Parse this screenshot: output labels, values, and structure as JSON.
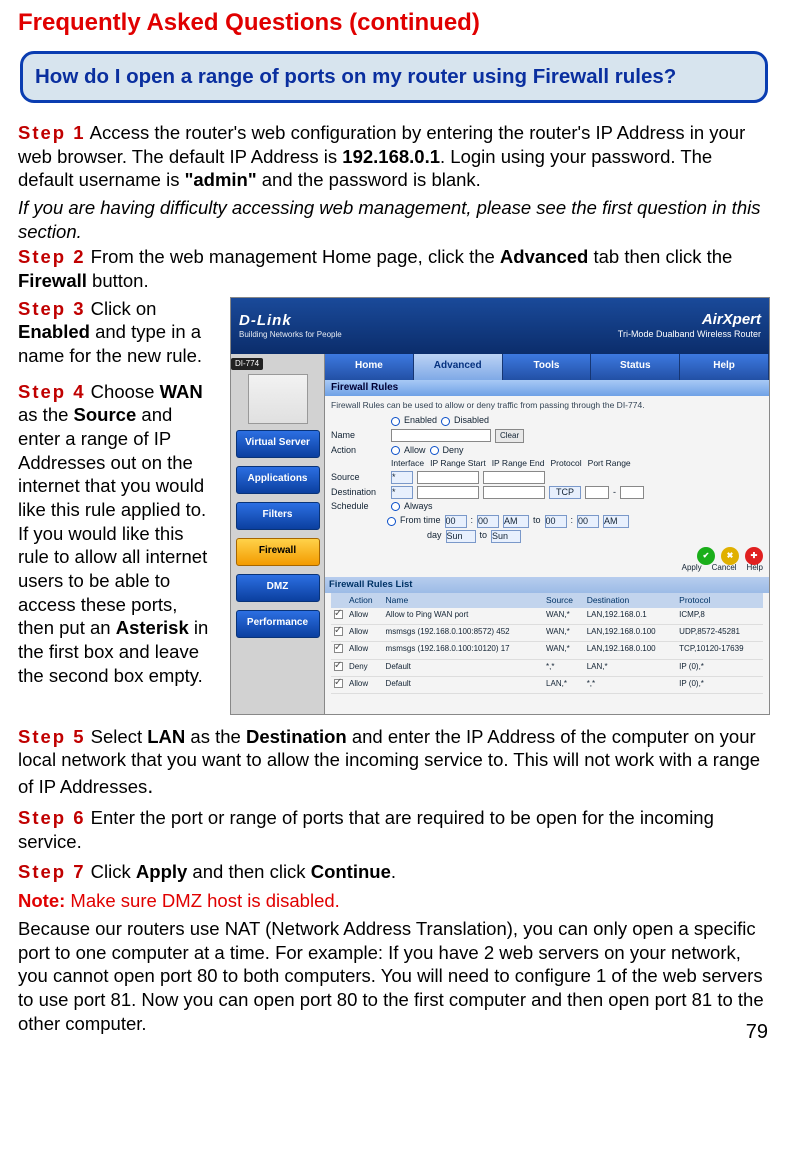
{
  "page_number": "79",
  "title": "Frequently Asked Questions (continued)",
  "question": "How do I open a range of ports on my router using Firewall rules?",
  "step1": {
    "label": "Step 1",
    "text_a": " Access the router's web configuration by entering the router's IP Address in your web browser. The default IP Address is ",
    "ip": "192.168.0.1",
    "text_b": ". Login using your password. The default username is ",
    "user": "\"admin\"",
    "text_c": " and the password is blank."
  },
  "trouble_note": "If you are having difficulty accessing web management, please see the first question in this section.",
  "step2": {
    "label": "Step 2",
    "text_a": " From the web management Home page, click the ",
    "advanced": "Advanced",
    "text_b": " tab then click the ",
    "firewall": "Firewall",
    "text_c": " button."
  },
  "step3": {
    "label": "Step 3",
    "text_a": " Click on ",
    "enabled": "Enabled",
    "text_b": " and type in a name for the new rule."
  },
  "step4": {
    "label": "Step 4",
    "text_a": " Choose ",
    "wan": "WAN",
    "text_b": " as the ",
    "source": "Source",
    "text_c": " and enter a range of IP Addresses out on the internet that you would like this rule applied to. If you would like this rule to allow all internet users to be able to access these ports, then put an ",
    "asterisk": "Asterisk",
    "text_d": " in the first box and leave the second box empty."
  },
  "step5": {
    "label": "Step 5",
    "text_a": " Select ",
    "lan": "LAN",
    "text_b": " as the ",
    "destination": "Destination",
    "text_c": " and enter the IP Address of the computer on your local network that you want to allow the incoming service to. This will not work with a range of IP Addresses",
    "dot": "."
  },
  "step6": {
    "label": "Step 6",
    "text": " Enter the port or range of ports that are required to be open for the incoming service."
  },
  "step7": {
    "label": "Step 7",
    "text_a": " Click ",
    "apply": "Apply",
    "text_b": " and then click ",
    "continue": "Continue",
    "dot": "."
  },
  "note": {
    "label": "Note:",
    "red_text": " Make sure DMZ host is disabled.",
    "body": "Because our routers use NAT (Network Address Translation), you can only open a specific port to one computer at a time. For example: If you have 2 web servers on your network, you cannot open port 80 to both computers. You will need to configure 1 of the web servers to use port 81. Now you can open port 80 to the first computer and then open port 81 to the other computer."
  },
  "screenshot": {
    "brand": "D-Link",
    "brand_sub": "Building Networks for People",
    "brand_right": "AirXpert",
    "brand_right_sub": "Tri-Mode Dualband Wireless Router",
    "model": "DI-774",
    "tabs": [
      "Home",
      "Advanced",
      "Tools",
      "Status",
      "Help"
    ],
    "side_buttons": [
      "Virtual Server",
      "Applications",
      "Filters",
      "Firewall",
      "DMZ",
      "Performance"
    ],
    "panel_header": "Firewall Rules",
    "panel_desc": "Firewall Rules can be used to allow or deny traffic from passing through the DI-774.",
    "enabled_label": "Enabled",
    "disabled_label": "Disabled",
    "form": {
      "name": "Name",
      "clear": "Clear",
      "action": "Action",
      "allow": "Allow",
      "deny": "Deny",
      "cols": [
        "Interface",
        "IP Range Start",
        "IP Range End",
        "Protocol",
        "Port Range"
      ],
      "source": "Source",
      "destination": "Destination",
      "tcp": "TCP",
      "schedule": "Schedule",
      "always": "Always",
      "from": "From time",
      "to": "to",
      "day": "day",
      "t1": "00",
      "t2": "00",
      "am": "AM",
      "sun": "Sun"
    },
    "icons": {
      "apply": "Apply",
      "cancel": "Cancel",
      "help": "Help"
    },
    "list_header": "Firewall Rules List",
    "table_headers": [
      "",
      "Action",
      "Name",
      "Source",
      "Destination",
      "Protocol"
    ],
    "rows": [
      {
        "a": "Allow",
        "n": "Allow to Ping WAN port",
        "s": "WAN,*",
        "d": "LAN,192.168.0.1",
        "p": "ICMP,8"
      },
      {
        "a": "Allow",
        "n": "msmsgs (192.168.0.100:8572) 452",
        "s": "WAN,*",
        "d": "LAN,192.168.0.100",
        "p": "UDP,8572-45281"
      },
      {
        "a": "Allow",
        "n": "msmsgs (192.168.0.100:10120) 17",
        "s": "WAN,*",
        "d": "LAN,192.168.0.100",
        "p": "TCP,10120-17639"
      },
      {
        "a": "Deny",
        "n": "Default",
        "s": "*,*",
        "d": "LAN,*",
        "p": "IP (0),*"
      },
      {
        "a": "Allow",
        "n": "Default",
        "s": "LAN,*",
        "d": "*,*",
        "p": "IP (0),*"
      }
    ]
  }
}
